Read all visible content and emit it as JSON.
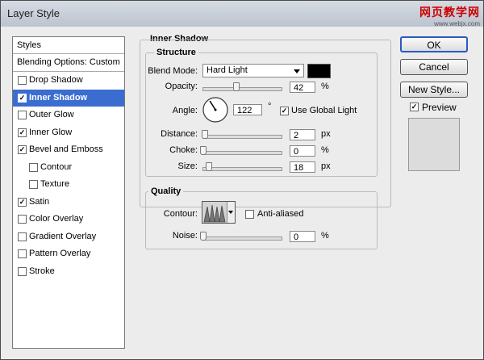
{
  "window": {
    "title": "Layer Style",
    "watermark_cn": "网页教学网",
    "watermark_url": "www.webjx.com"
  },
  "styles_panel": {
    "header": "Styles",
    "blending": "Blending Options: Custom",
    "items": [
      {
        "label": "Drop Shadow",
        "checked": false,
        "selected": false,
        "sub": false
      },
      {
        "label": "Inner Shadow",
        "checked": true,
        "selected": true,
        "sub": false
      },
      {
        "label": "Outer Glow",
        "checked": false,
        "selected": false,
        "sub": false
      },
      {
        "label": "Inner Glow",
        "checked": true,
        "selected": false,
        "sub": false
      },
      {
        "label": "Bevel and Emboss",
        "checked": true,
        "selected": false,
        "sub": false
      },
      {
        "label": "Contour",
        "checked": false,
        "selected": false,
        "sub": true
      },
      {
        "label": "Texture",
        "checked": false,
        "selected": false,
        "sub": true
      },
      {
        "label": "Satin",
        "checked": true,
        "selected": false,
        "sub": false
      },
      {
        "label": "Color Overlay",
        "checked": false,
        "selected": false,
        "sub": false
      },
      {
        "label": "Gradient Overlay",
        "checked": false,
        "selected": false,
        "sub": false
      },
      {
        "label": "Pattern Overlay",
        "checked": false,
        "selected": false,
        "sub": false
      },
      {
        "label": "Stroke",
        "checked": false,
        "selected": false,
        "sub": false
      }
    ]
  },
  "inner_shadow": {
    "title": "Inner Shadow",
    "structure": {
      "title": "Structure",
      "blend_mode_label": "Blend Mode:",
      "blend_mode": "Hard Light",
      "color": "#000000",
      "opacity_label": "Opacity:",
      "opacity": "42",
      "opacity_level": 0.42,
      "percent": "%",
      "angle_label": "Angle:",
      "angle": "122",
      "angle_value": 122,
      "degree": "°",
      "use_global_light": "Use Global Light",
      "use_global_light_checked": true,
      "distance_label": "Distance:",
      "distance": "2",
      "distance_level": 0.02,
      "px": "px",
      "choke_label": "Choke:",
      "choke": "0",
      "choke_level": 0.0,
      "size_label": "Size:",
      "size": "18",
      "size_level": 0.07
    },
    "quality": {
      "title": "Quality",
      "contour_label": "Contour:",
      "anti_aliased": "Anti-aliased",
      "anti_aliased_checked": false,
      "noise_label": "Noise:",
      "noise": "0",
      "noise_level": 0.0
    }
  },
  "buttons": {
    "ok": "OK",
    "cancel": "Cancel",
    "new_style": "New Style...",
    "preview": "Preview",
    "preview_checked": true
  }
}
